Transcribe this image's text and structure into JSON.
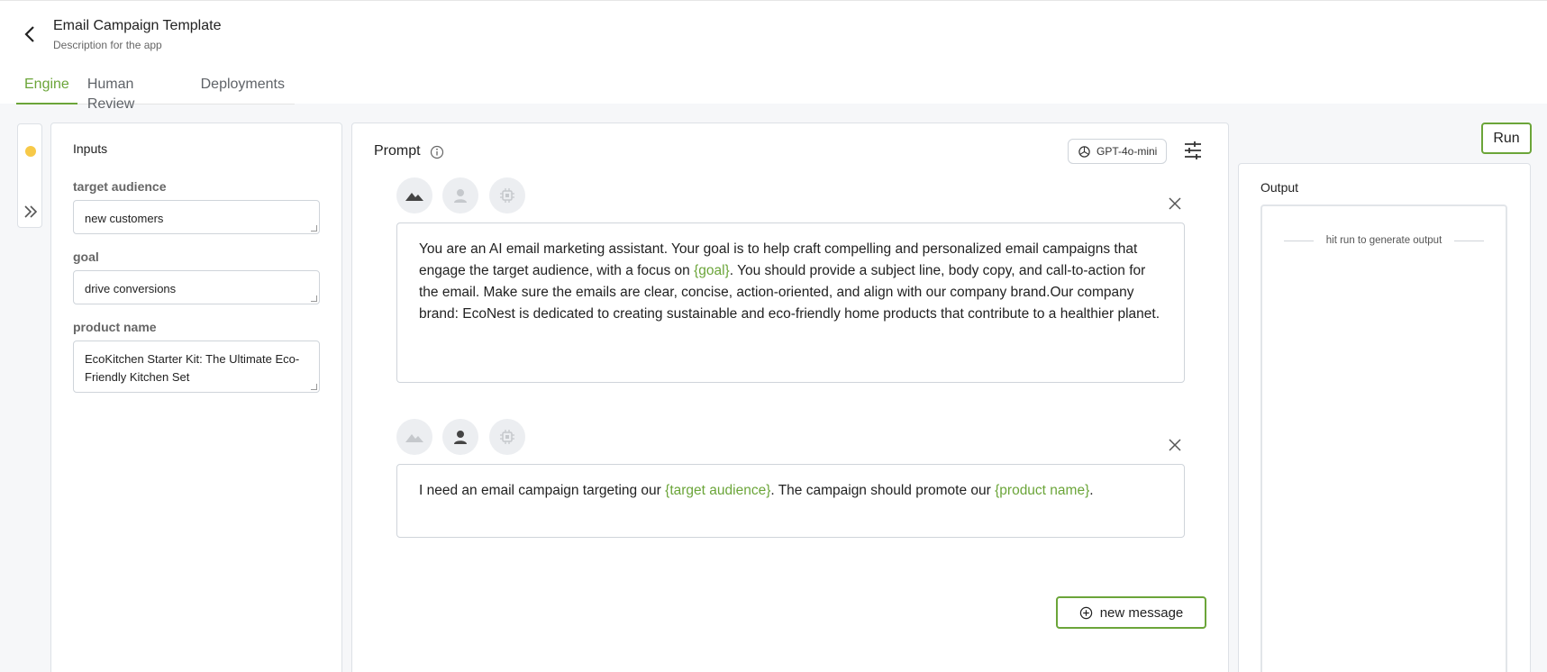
{
  "header": {
    "title": "Email Campaign Template",
    "description": "Description for the app",
    "back_icon": "chevron-left-icon"
  },
  "tabs": [
    {
      "label": "Engine",
      "active": true
    },
    {
      "label": "Human Review",
      "active": false
    },
    {
      "label": "Deployments",
      "active": false
    }
  ],
  "inputs": {
    "title": "Inputs",
    "fields": [
      {
        "label": "target audience",
        "value": "new customers"
      },
      {
        "label": "goal",
        "value": "drive conversions"
      },
      {
        "label": "product name",
        "value": "EcoKitchen Starter Kit: The Ultimate Eco-Friendly Kitchen Set"
      }
    ]
  },
  "prompt": {
    "title": "Prompt",
    "model": "GPT-4o-mini",
    "messages": [
      {
        "role": "system",
        "parts": [
          "You are an AI email marketing assistant. Your goal is to help craft compelling and personalized email campaigns that engage the target audience, with a focus on ",
          "{goal}",
          ". You should provide a subject line, body copy, and call-to-action for the email. Make sure the emails are clear, concise, action-oriented, and align with our company brand.Our company brand: EcoNest is dedicated to creating sustainable and eco-friendly home products that contribute to a healthier planet."
        ]
      },
      {
        "role": "user",
        "parts": [
          "I need an email campaign targeting our ",
          "{target audience}",
          ". The campaign should promote our ",
          "{product name}",
          "."
        ]
      }
    ],
    "new_message_label": "new message"
  },
  "run_label": "Run",
  "output": {
    "title": "Output",
    "placeholder": "hit run to generate output"
  },
  "colors": {
    "accent": "#6ba539",
    "status_dot": "#f7c948"
  }
}
